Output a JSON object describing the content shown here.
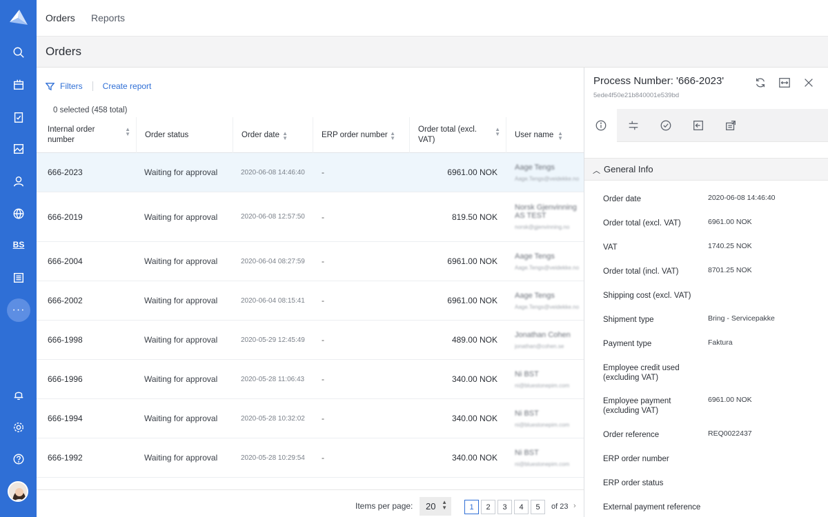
{
  "nav": {
    "tabs": [
      "Orders",
      "Reports"
    ]
  },
  "page": {
    "title": "Orders"
  },
  "toolbar": {
    "filters": "Filters",
    "create_report": "Create report"
  },
  "selection": {
    "text": "0 selected (458 total)"
  },
  "columns": [
    "Internal order number",
    "Order status",
    "Order date",
    "ERP order number",
    "Order total (excl. VAT)",
    "User name"
  ],
  "rows": [
    {
      "id": "666-2023",
      "status": "Waiting for approval",
      "date": "2020-06-08 14:46:40",
      "erp": "-",
      "total": "6961.00 NOK",
      "user": "Aage Tengs",
      "email": "Aage.Tengs@veidekke.no"
    },
    {
      "id": "666-2019",
      "status": "Waiting for approval",
      "date": "2020-06-08 12:57:50",
      "erp": "-",
      "total": "819.50 NOK",
      "user": "Norsk Gjenvinning AS TEST",
      "email": "norsk@gjenvinning.no"
    },
    {
      "id": "666-2004",
      "status": "Waiting for approval",
      "date": "2020-06-04 08:27:59",
      "erp": "-",
      "total": "6961.00 NOK",
      "user": "Aage Tengs",
      "email": "Aage.Tengs@veidekke.no"
    },
    {
      "id": "666-2002",
      "status": "Waiting for approval",
      "date": "2020-06-04 08:15:41",
      "erp": "-",
      "total": "6961.00 NOK",
      "user": "Aage Tengs",
      "email": "Aage.Tengs@veidekke.no"
    },
    {
      "id": "666-1998",
      "status": "Waiting for approval",
      "date": "2020-05-29 12:45:49",
      "erp": "-",
      "total": "489.00 NOK",
      "user": "Jonathan Cohen",
      "email": "jonathan@cohen.se"
    },
    {
      "id": "666-1996",
      "status": "Waiting for approval",
      "date": "2020-05-28 11:06:43",
      "erp": "-",
      "total": "340.00 NOK",
      "user": "Ni BST",
      "email": "ni@bluestonepim.com"
    },
    {
      "id": "666-1994",
      "status": "Waiting for approval",
      "date": "2020-05-28 10:32:02",
      "erp": "-",
      "total": "340.00 NOK",
      "user": "Ni BST",
      "email": "ni@bluestonepim.com"
    },
    {
      "id": "666-1992",
      "status": "Waiting for approval",
      "date": "2020-05-28 10:29:54",
      "erp": "-",
      "total": "340.00 NOK",
      "user": "Ni BST",
      "email": "ni@bluestonepim.com"
    }
  ],
  "pagination": {
    "items_label": "Items per page:",
    "per_page": "20",
    "pages": [
      "1",
      "2",
      "3",
      "4",
      "5"
    ],
    "current": "1",
    "of": "of 23",
    "next": "›"
  },
  "panel": {
    "title": "Process Number: '666-2023'",
    "subtitle": "5ede4f50e21b840001e539bd",
    "section": "General Info",
    "fields": [
      {
        "label": "Order date",
        "value": "2020-06-08 14:46:40"
      },
      {
        "label": "Order total (excl. VAT)",
        "value": "6961.00 NOK"
      },
      {
        "label": "VAT",
        "value": "1740.25 NOK"
      },
      {
        "label": "Order total (incl. VAT)",
        "value": "8701.25 NOK"
      },
      {
        "label": "Shipping cost (excl. VAT)",
        "value": ""
      },
      {
        "label": "Shipment type",
        "value": "Bring - Servicepakke"
      },
      {
        "label": "Payment type",
        "value": "Faktura"
      },
      {
        "label": "Employee credit used (excluding VAT)",
        "value": ""
      },
      {
        "label": "Employee payment (excluding VAT)",
        "value": "6961.00 NOK"
      },
      {
        "label": "Order reference",
        "value": "REQ0022437"
      },
      {
        "label": "ERP order number",
        "value": ""
      },
      {
        "label": "ERP order status",
        "value": ""
      },
      {
        "label": "External payment reference",
        "value": ""
      }
    ]
  },
  "rail": {
    "bs_label": "BS",
    "more_label": "···"
  },
  "colors": {
    "primary": "#2f6fd6",
    "selected_row": "#eef6fc"
  }
}
